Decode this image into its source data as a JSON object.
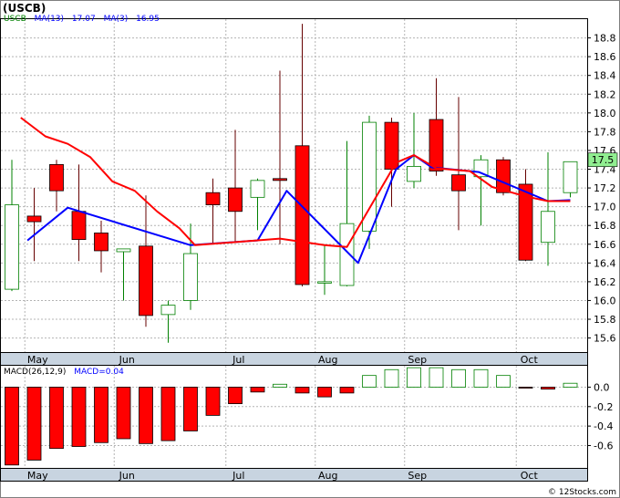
{
  "title": "(USCB)",
  "watermark": "© 12Stocks.com",
  "chart_data": [
    {
      "type": "candlestick",
      "title": "(USCB)",
      "legend": [
        {
          "text": "USCB",
          "color": "#008000"
        },
        {
          "text": "MA(13)",
          "color": "#0000ff"
        },
        {
          "text": "17.07",
          "color": "#0000ff"
        },
        {
          "text": "MA(3)",
          "color": "#0000ff"
        },
        {
          "text": "16.95",
          "color": "#0000ff"
        }
      ],
      "ylim": [
        15.45,
        19.0
      ],
      "yticks": [
        15.6,
        15.8,
        16.0,
        16.2,
        16.4,
        16.6,
        16.8,
        17.0,
        17.2,
        17.4,
        17.6,
        17.8,
        18.0,
        18.2,
        18.4,
        18.6,
        18.8
      ],
      "ytick_labels": [
        "15.6",
        "15.8",
        "16.0",
        "16.2",
        "16.4",
        "16.6",
        "16.8",
        "17.0",
        "17.2",
        "17.4",
        "17.6",
        "17.8",
        "18.0",
        "18.2",
        "18.4",
        "18.6",
        "18.8"
      ],
      "xtick_labels": [
        "May",
        "Jun",
        "Jul",
        "Aug",
        "Sep",
        "Oct"
      ],
      "xtick_index": [
        1,
        5,
        10,
        14,
        18,
        23
      ],
      "last_price_label": "17.5",
      "last_price": 17.5,
      "grid": true,
      "up_color": "#008000",
      "down_color": "#ff0000",
      "candles": [
        {
          "o": 16.12,
          "h": 17.5,
          "l": 16.1,
          "c": 17.02
        },
        {
          "o": 16.9,
          "h": 17.2,
          "l": 16.42,
          "c": 16.84
        },
        {
          "o": 17.45,
          "h": 17.5,
          "l": 16.95,
          "c": 17.17
        },
        {
          "o": 16.95,
          "h": 17.45,
          "l": 16.42,
          "c": 16.65
        },
        {
          "o": 16.72,
          "h": 16.85,
          "l": 16.3,
          "c": 16.53
        },
        {
          "o": 16.52,
          "h": 16.55,
          "l": 16.0,
          "c": 16.55
        },
        {
          "o": 16.58,
          "h": 17.12,
          "l": 15.72,
          "c": 15.84
        },
        {
          "o": 15.85,
          "h": 16.0,
          "l": 15.55,
          "c": 15.95
        },
        {
          "o": 16.0,
          "h": 16.82,
          "l": 15.9,
          "c": 16.5
        },
        {
          "o": 17.15,
          "h": 17.3,
          "l": 16.6,
          "c": 17.02
        },
        {
          "o": 17.2,
          "h": 17.82,
          "l": 16.62,
          "c": 16.95
        },
        {
          "o": 17.1,
          "h": 17.3,
          "l": 16.75,
          "c": 17.28
        },
        {
          "o": 17.3,
          "h": 18.45,
          "l": 16.6,
          "c": 17.28
        },
        {
          "o": 17.65,
          "h": 18.95,
          "l": 16.15,
          "c": 16.17
        },
        {
          "o": 16.2,
          "h": 16.6,
          "l": 16.06,
          "c": 16.2
        },
        {
          "o": 16.16,
          "h": 17.7,
          "l": 16.15,
          "c": 16.82
        },
        {
          "o": 16.74,
          "h": 17.97,
          "l": 16.55,
          "c": 17.9
        },
        {
          "o": 17.9,
          "h": 17.95,
          "l": 17.0,
          "c": 17.4
        },
        {
          "o": 17.27,
          "h": 18.0,
          "l": 17.2,
          "c": 17.43
        },
        {
          "o": 17.93,
          "h": 18.37,
          "l": 17.33,
          "c": 17.38
        },
        {
          "o": 17.34,
          "h": 18.17,
          "l": 16.75,
          "c": 17.17
        },
        {
          "o": 17.32,
          "h": 17.55,
          "l": 16.8,
          "c": 17.5
        },
        {
          "o": 17.5,
          "h": 17.53,
          "l": 17.12,
          "c": 17.15
        },
        {
          "o": 17.24,
          "h": 17.4,
          "l": 16.42,
          "c": 16.43
        },
        {
          "o": 16.62,
          "h": 17.58,
          "l": 16.37,
          "c": 16.95
        },
        {
          "o": 17.15,
          "h": 17.48,
          "l": 17.1,
          "c": 17.48
        }
      ],
      "series": [
        {
          "name": "MA(13)",
          "color": "#0000ff",
          "points": [
            [
              0.7,
              16.64
            ],
            [
              2.5,
              16.99
            ],
            [
              8.0,
              16.59
            ],
            [
              11.0,
              16.64
            ],
            [
              12.3,
              17.17
            ],
            [
              15.5,
              16.4
            ],
            [
              17.2,
              17.4
            ],
            [
              18.0,
              17.55
            ],
            [
              18.8,
              17.42
            ],
            [
              20.9,
              17.37
            ],
            [
              24.0,
              17.06
            ],
            [
              25.0,
              17.07
            ]
          ]
        },
        {
          "name": "MA(3)",
          "color": "#ff0000",
          "points": [
            [
              0.4,
              17.95
            ],
            [
              1.5,
              17.75
            ],
            [
              2.5,
              17.67
            ],
            [
              3.5,
              17.53
            ],
            [
              4.5,
              17.27
            ],
            [
              5.5,
              17.17
            ],
            [
              6.5,
              16.95
            ],
            [
              7.5,
              16.77
            ],
            [
              8.2,
              16.59
            ],
            [
              12.0,
              16.66
            ],
            [
              14.0,
              16.59
            ],
            [
              15.0,
              16.57
            ],
            [
              17.2,
              17.47
            ],
            [
              18.0,
              17.55
            ],
            [
              19.0,
              17.41
            ],
            [
              20.5,
              17.38
            ],
            [
              21.5,
              17.21
            ],
            [
              23.0,
              17.11
            ],
            [
              24.0,
              17.06
            ],
            [
              25.0,
              17.06
            ]
          ]
        }
      ]
    },
    {
      "type": "bar",
      "title": "",
      "legend": [
        {
          "text": "MACD(26,12,9)",
          "color": "#000000"
        },
        {
          "text": "MACD=0.04",
          "color": "#0000ff"
        }
      ],
      "ylim": [
        -0.83,
        0.22
      ],
      "yticks": [
        0.0,
        -0.2,
        -0.4,
        -0.6
      ],
      "ytick_labels": [
        "0.0",
        "-0.2",
        "-0.4",
        "-0.6"
      ],
      "xtick_labels": [
        "May",
        "Jun",
        "Jul",
        "Aug",
        "Sep",
        "Oct"
      ],
      "xtick_index": [
        1,
        5,
        10,
        14,
        18,
        23
      ],
      "values": [
        -0.8,
        -0.75,
        -0.63,
        -0.61,
        -0.57,
        -0.53,
        -0.58,
        -0.55,
        -0.45,
        -0.29,
        -0.17,
        -0.05,
        0.03,
        -0.06,
        -0.1,
        -0.06,
        0.12,
        0.18,
        0.2,
        0.2,
        0.18,
        0.18,
        0.12,
        -0.01,
        -0.02,
        0.04
      ],
      "pos_color": "#008000",
      "neg_color": "#ff0000"
    }
  ]
}
